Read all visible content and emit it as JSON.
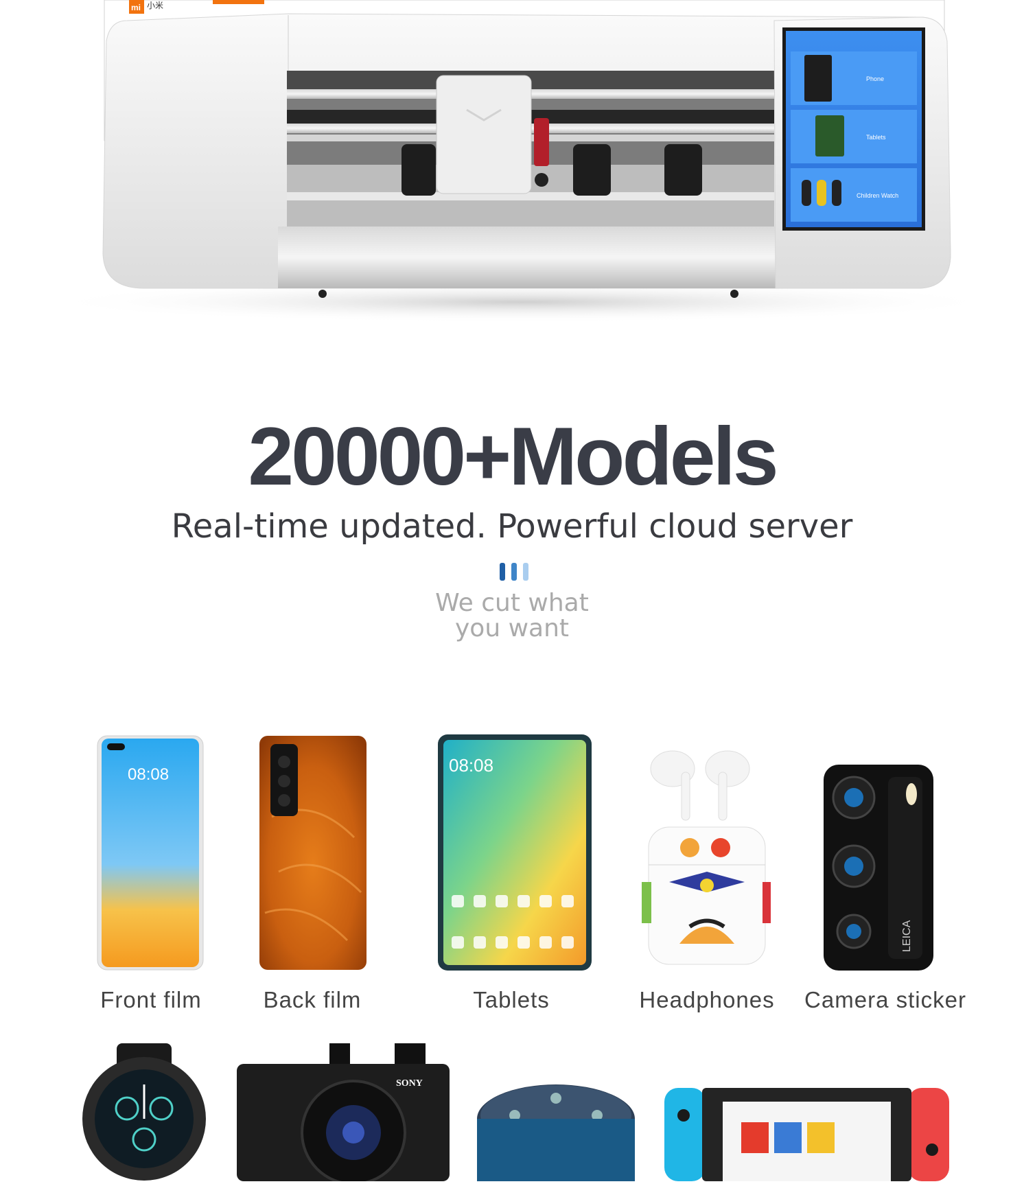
{
  "machine": {
    "brand_badge": "mi",
    "brand_text": "小米",
    "screen_items": [
      {
        "label": "Phone"
      },
      {
        "label": "Tablets"
      },
      {
        "label": "Children Watch"
      }
    ]
  },
  "hero": {
    "title": "20000+Models",
    "subtitle": "Real-time updated. Powerful cloud server",
    "tagline_line1": "We cut what",
    "tagline_line2": "you want"
  },
  "products": [
    {
      "label": "Front film",
      "screen_time": "08:08"
    },
    {
      "label": "Back film"
    },
    {
      "label": "Tablets",
      "screen_time": "08:08"
    },
    {
      "label": "Headphones"
    },
    {
      "label": "Camera sticker",
      "lens_brand": "LEICA"
    }
  ],
  "second_row": {
    "camera_brand": "SONY"
  },
  "colors": {
    "title": "#3a3d47",
    "bar_dark": "#1f5fa6",
    "bar_mid": "#3f85c8",
    "bar_light": "#a9cdef"
  }
}
